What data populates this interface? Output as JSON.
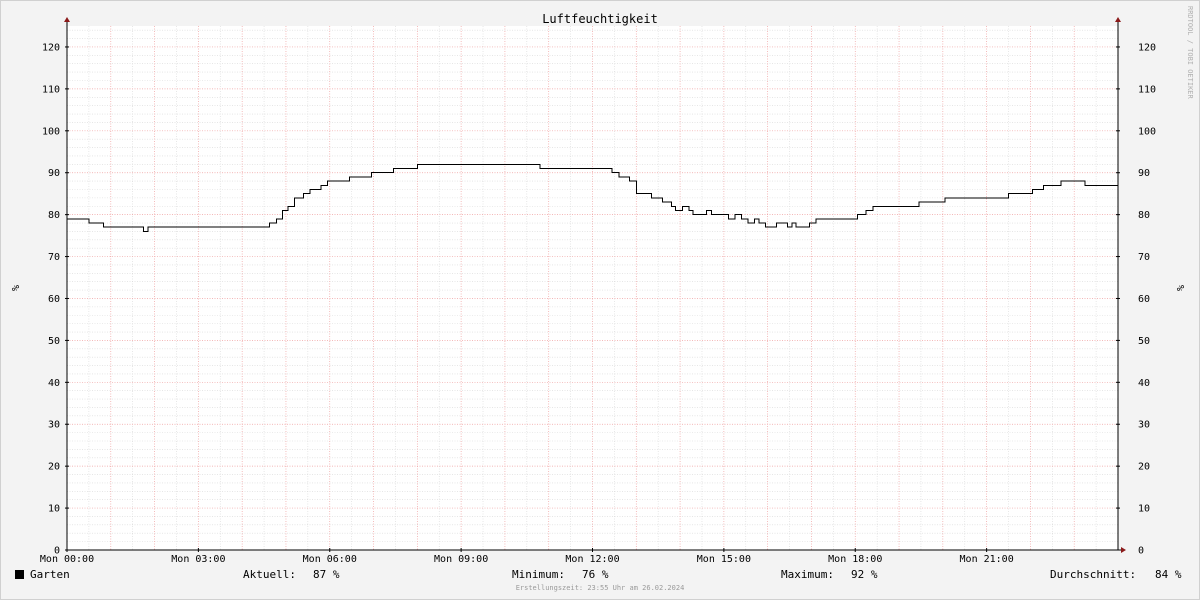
{
  "chart_data": {
    "type": "line",
    "title": "Luftfeuchtigkeit",
    "ylabel_left": "%",
    "ylabel_right": "%",
    "watermark": "RRDTOOL / TOBI OETIKER",
    "ylim": [
      0,
      125
    ],
    "yticks": [
      0,
      10,
      20,
      30,
      40,
      50,
      60,
      70,
      80,
      90,
      100,
      110,
      120
    ],
    "xlim": [
      0,
      24
    ],
    "xticks": [
      {
        "x": 0,
        "label": "Mon 00:00"
      },
      {
        "x": 3,
        "label": "Mon 03:00"
      },
      {
        "x": 6,
        "label": "Mon 06:00"
      },
      {
        "x": 9,
        "label": "Mon 09:00"
      },
      {
        "x": 12,
        "label": "Mon 12:00"
      },
      {
        "x": 15,
        "label": "Mon 15:00"
      },
      {
        "x": 18,
        "label": "Mon 18:00"
      },
      {
        "x": 21,
        "label": "Mon 21:00"
      }
    ],
    "grid": true,
    "legend_position": "bottom-left",
    "series": [
      {
        "name": "Garten",
        "color": "#000000",
        "step": true,
        "points": [
          [
            0.0,
            79
          ],
          [
            0.5,
            78
          ],
          [
            0.83,
            77
          ],
          [
            1.75,
            76
          ],
          [
            1.85,
            77
          ],
          [
            4.6,
            77
          ],
          [
            4.62,
            78
          ],
          [
            4.78,
            79
          ],
          [
            4.92,
            81
          ],
          [
            5.05,
            82
          ],
          [
            5.2,
            84
          ],
          [
            5.4,
            85
          ],
          [
            5.55,
            86
          ],
          [
            5.8,
            87
          ],
          [
            5.95,
            88
          ],
          [
            6.45,
            89
          ],
          [
            6.95,
            90
          ],
          [
            7.45,
            91
          ],
          [
            7.9,
            91
          ],
          [
            8.0,
            92
          ],
          [
            10.8,
            91
          ],
          [
            12.45,
            90
          ],
          [
            12.6,
            89
          ],
          [
            12.85,
            88
          ],
          [
            13.0,
            85
          ],
          [
            13.35,
            84
          ],
          [
            13.6,
            83
          ],
          [
            13.8,
            82
          ],
          [
            13.9,
            81
          ],
          [
            14.05,
            82
          ],
          [
            14.2,
            81
          ],
          [
            14.3,
            80
          ],
          [
            14.5,
            80
          ],
          [
            14.6,
            81
          ],
          [
            14.72,
            80
          ],
          [
            15.0,
            80
          ],
          [
            15.1,
            79
          ],
          [
            15.25,
            80
          ],
          [
            15.4,
            79
          ],
          [
            15.55,
            78
          ],
          [
            15.7,
            79
          ],
          [
            15.8,
            78
          ],
          [
            15.95,
            77
          ],
          [
            16.2,
            78
          ],
          [
            16.45,
            77
          ],
          [
            16.55,
            78
          ],
          [
            16.65,
            77
          ],
          [
            16.95,
            78
          ],
          [
            17.1,
            79
          ],
          [
            18.05,
            80
          ],
          [
            18.25,
            81
          ],
          [
            18.4,
            82
          ],
          [
            19.45,
            83
          ],
          [
            20.05,
            84
          ],
          [
            21.5,
            85
          ],
          [
            22.05,
            86
          ],
          [
            22.3,
            87
          ],
          [
            22.7,
            88
          ],
          [
            23.25,
            87
          ],
          [
            24.0,
            87
          ]
        ]
      }
    ]
  },
  "legend": {
    "series_name": "Garten",
    "current_label": "Aktuell:",
    "current_value": "87 %",
    "min_label": "Minimum:",
    "min_value": "76 %",
    "max_label": "Maximum:",
    "max_value": "92 %",
    "avg_label": "Durchschnitt:",
    "avg_value": "84 %"
  },
  "created_text": "Erstellungszeit: 23:55 Uhr am 26.02.2024"
}
